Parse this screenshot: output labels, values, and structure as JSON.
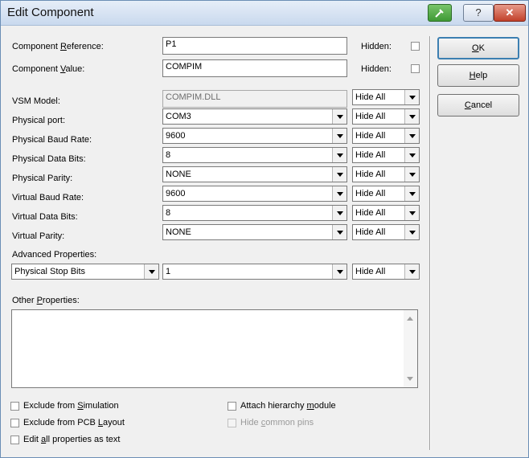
{
  "window": {
    "title": "Edit Component"
  },
  "titlebar": {
    "help_glyph": "?",
    "close_glyph": "✕"
  },
  "fields": {
    "reference": {
      "label_pre": "Component ",
      "label_u": "R",
      "label_post": "eference:",
      "value": "P1"
    },
    "value": {
      "label_pre": "Component ",
      "label_u": "V",
      "label_post": "alue:",
      "value": "COMPIM"
    },
    "hidden_label": "Hidden:"
  },
  "properties": [
    {
      "label": "VSM Model:",
      "value": "COMPIM.DLL",
      "visibility": "Hide All"
    },
    {
      "label": "Physical port:",
      "value": "COM3",
      "visibility": "Hide All"
    },
    {
      "label": "Physical Baud Rate:",
      "value": "9600",
      "visibility": "Hide All"
    },
    {
      "label": "Physical Data Bits:",
      "value": "8",
      "visibility": "Hide All"
    },
    {
      "label": "Physical Parity:",
      "value": "NONE",
      "visibility": "Hide All"
    },
    {
      "label": "Virtual Baud Rate:",
      "value": "9600",
      "visibility": "Hide All"
    },
    {
      "label": "Virtual Data Bits:",
      "value": "8",
      "visibility": "Hide All"
    },
    {
      "label": "Virtual Parity:",
      "value": "NONE",
      "visibility": "Hide All"
    }
  ],
  "advanced": {
    "label": "Advanced Properties:",
    "property": "Physical Stop Bits",
    "value": "1",
    "visibility": "Hide All"
  },
  "other": {
    "label_pre": "Other ",
    "label_u": "P",
    "label_post": "roperties:",
    "text": ""
  },
  "buttons": {
    "ok": {
      "u": "O",
      "rest": "K"
    },
    "help": {
      "u": "H",
      "rest": "elp"
    },
    "cancel": {
      "u": "C",
      "rest": "ancel"
    }
  },
  "checkboxes": {
    "exclude_sim": {
      "pre": "Exclude from ",
      "u": "S",
      "post": "imulation",
      "checked": false
    },
    "exclude_pcb": {
      "pre": "Exclude from PCB ",
      "u": "L",
      "post": "ayout",
      "checked": false
    },
    "edit_all": {
      "pre": "Edit ",
      "u": "a",
      "post": "ll properties as text",
      "checked": false
    },
    "attach_hier": {
      "pre": "Attach hierarchy ",
      "u": "m",
      "post": "odule",
      "checked": false
    },
    "hide_pins": {
      "pre": "Hide ",
      "u": "c",
      "post": "ommon pins",
      "checked": false,
      "disabled": true
    }
  },
  "colors": {
    "titlebar": "#c9d9ee",
    "close": "#c2412b",
    "pin": "#3f9a35",
    "default_border": "#3c7fb1"
  },
  "icons": [
    "pin-icon",
    "help-icon",
    "close-icon",
    "dropdown-arrow-icon",
    "scroll-up-icon",
    "scroll-down-icon"
  ]
}
